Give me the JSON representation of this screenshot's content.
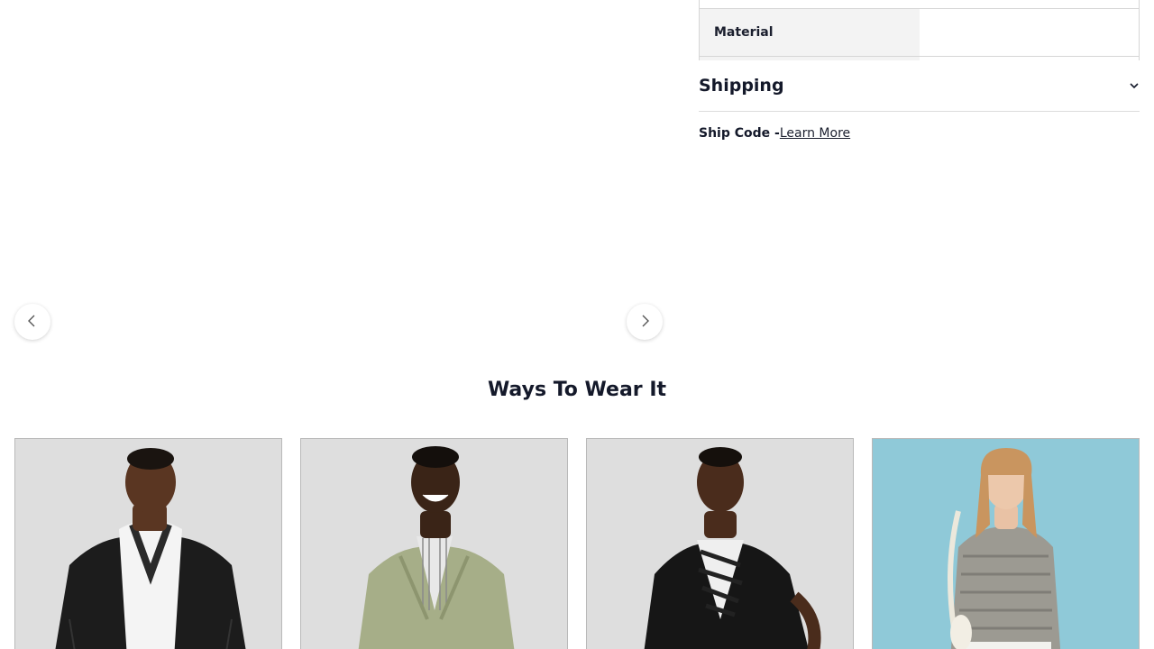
{
  "gallery": {
    "prev_icon": "chevron-left-icon",
    "next_icon": "chevron-right-icon"
  },
  "specs": {
    "rows": [
      {
        "label": "Material",
        "value": ""
      }
    ]
  },
  "shipping": {
    "title": "Shipping",
    "toggle_icon": "chevron-down-icon",
    "ship_code_label": "Ship Code -",
    "learn_more": "Learn More"
  },
  "ways_to_wear": {
    "title": "Ways To Wear It",
    "cards": [
      {
        "style": "black-leather-moto-jacket-white-hoodie",
        "bg": "#dedede"
      },
      {
        "style": "olive-moto-jacket-striped-shirt",
        "bg": "#dedede"
      },
      {
        "style": "black-leather-jacket-zebra-dress",
        "bg": "#dedede"
      },
      {
        "style": "grey-knit-sweater-jeans",
        "bg": "#8fc9d8"
      }
    ]
  },
  "colors": {
    "text": "#14192a",
    "spec_key_bg": "#f3f3f3",
    "border": "#d6d6d6"
  }
}
